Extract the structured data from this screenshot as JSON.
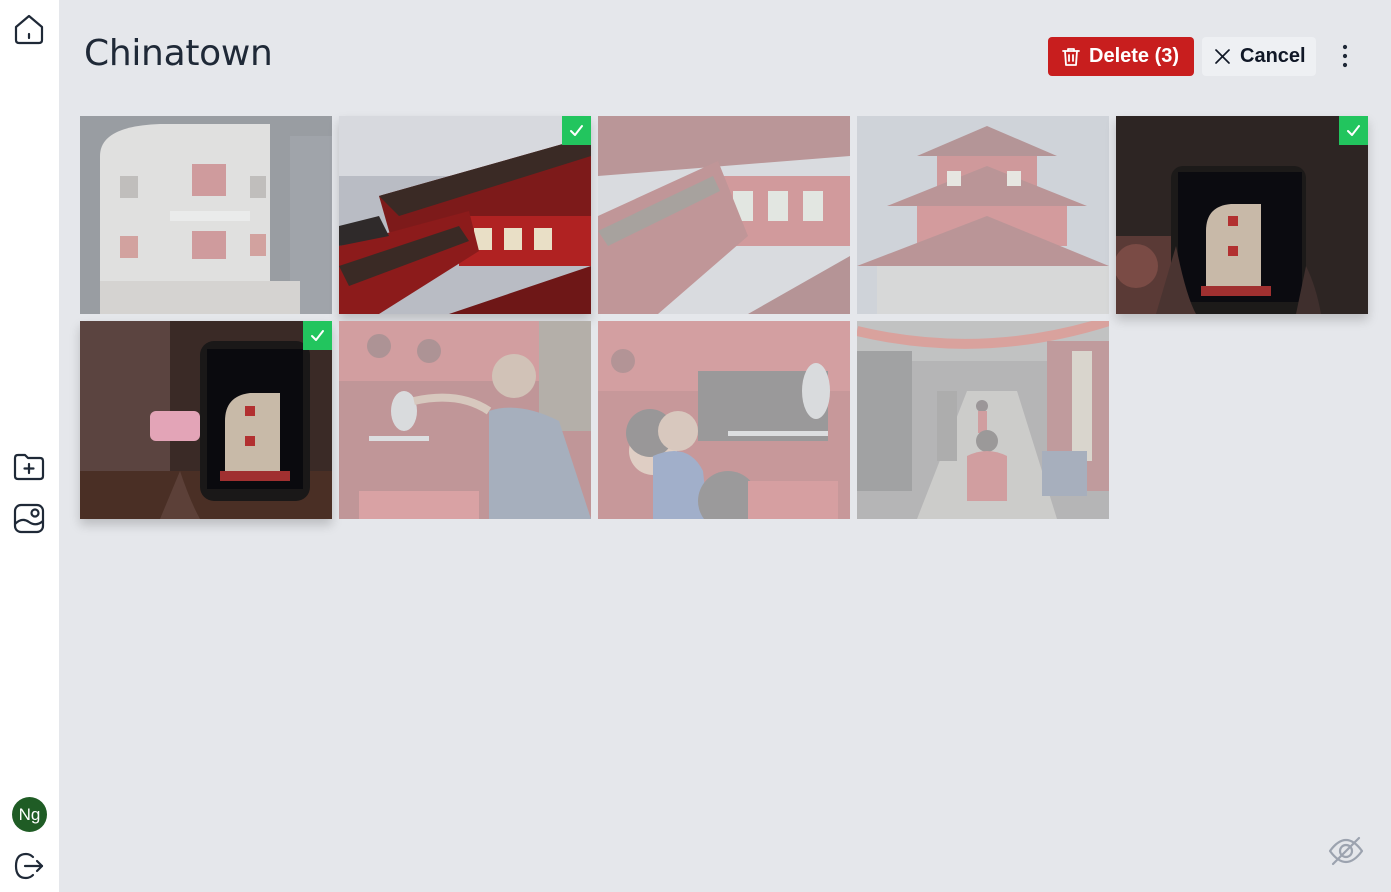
{
  "album": {
    "title": "Chinatown"
  },
  "toolbar": {
    "delete_label": "Delete (3)",
    "cancel_label": "Cancel"
  },
  "user": {
    "initials": "Ng",
    "avatar_color": "#1f5c25"
  },
  "colors": {
    "danger": "#c81e1e",
    "selected_check": "#22c55e",
    "background": "#e5e7eb"
  },
  "sidebar": {
    "icons": [
      "home-icon",
      "folder-plus-icon",
      "photo-album-icon",
      "logout-icon"
    ]
  },
  "photos": [
    {
      "subject": "corner-building",
      "selected": false
    },
    {
      "subject": "temple-roofs",
      "selected": true
    },
    {
      "subject": "temple-eaves",
      "selected": false
    },
    {
      "subject": "temple-tower",
      "selected": false
    },
    {
      "subject": "phone-screen",
      "selected": true
    },
    {
      "subject": "phone-screen",
      "selected": true
    },
    {
      "subject": "parrot-man",
      "selected": false
    },
    {
      "subject": "parrot-children",
      "selected": false
    },
    {
      "subject": "street-lanterns",
      "selected": false
    }
  ]
}
